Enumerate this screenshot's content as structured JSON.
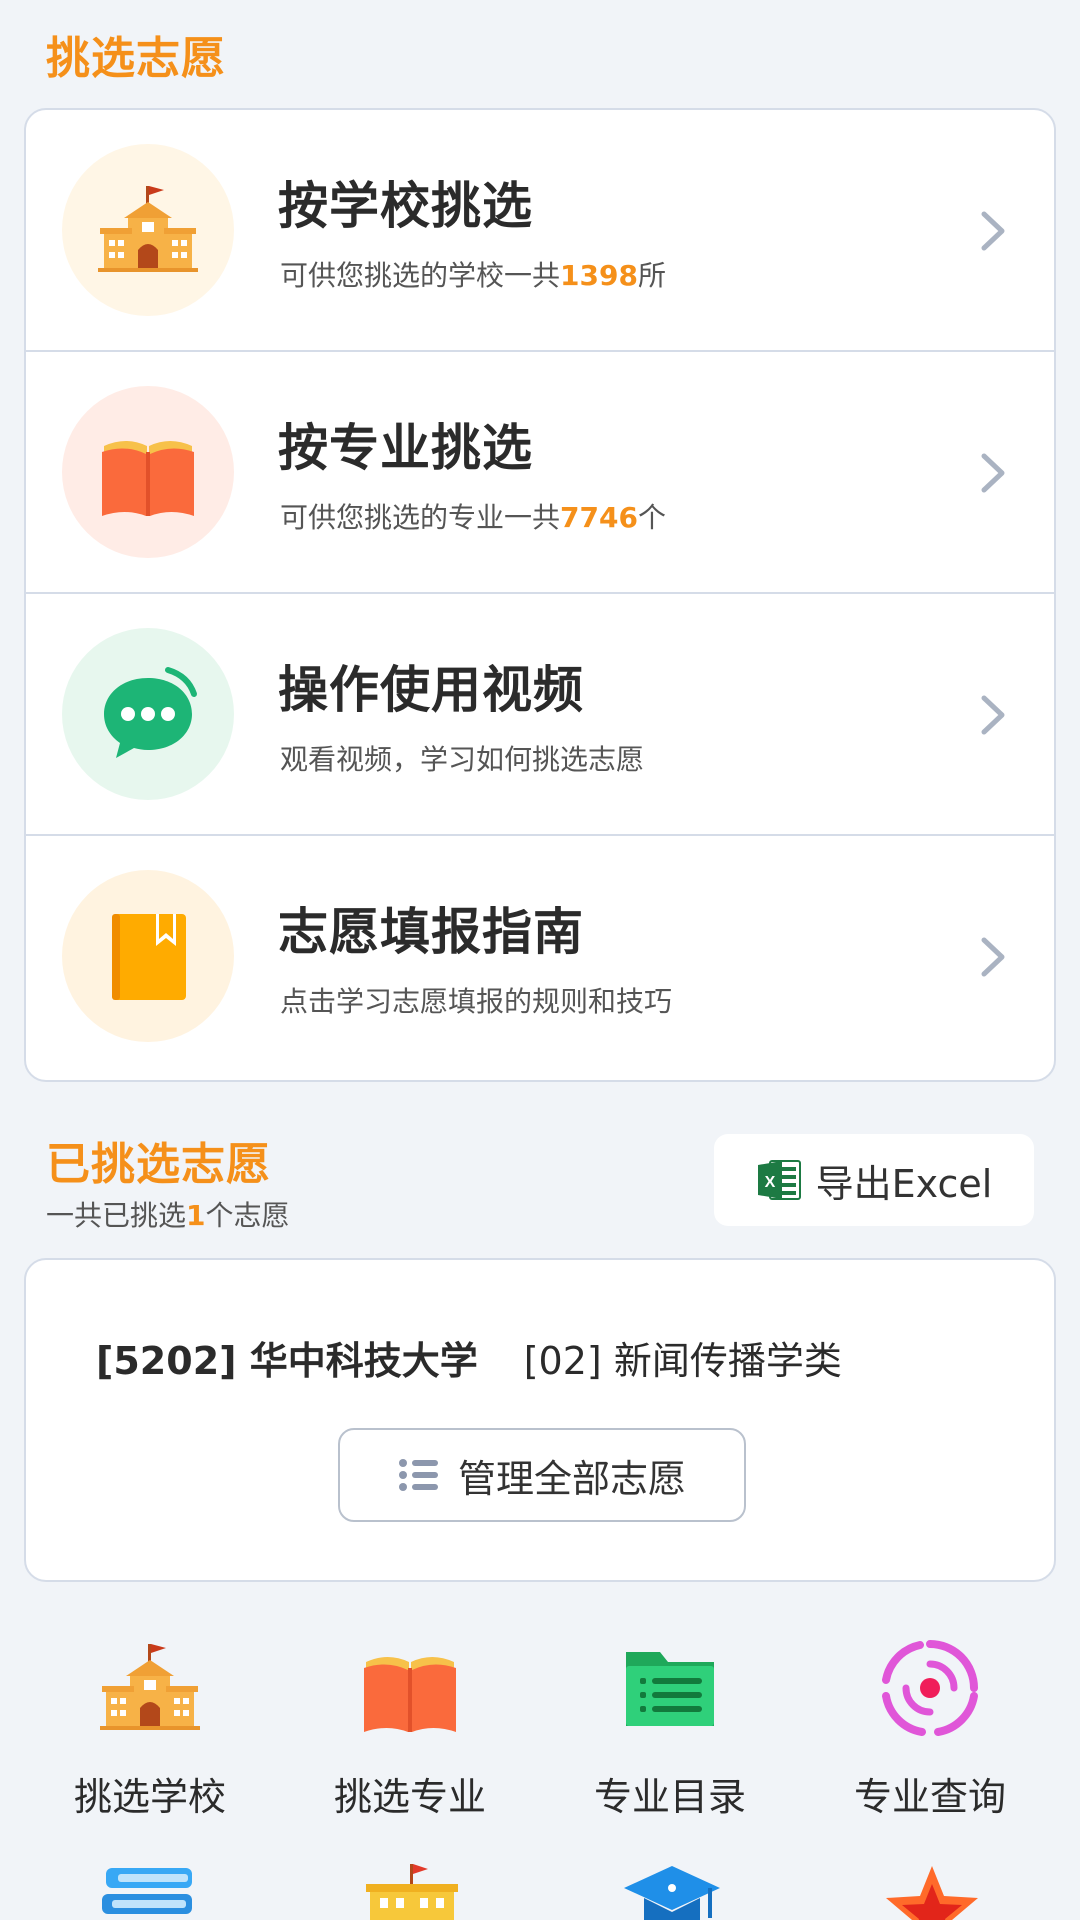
{
  "header": {
    "title": "挑选志愿"
  },
  "options": [
    {
      "title": "按学校挑选",
      "sub_prefix": "可供您挑选的学校一共",
      "count": "1398",
      "sub_suffix": "所",
      "icon": "school-icon",
      "bg": "#fff6e6"
    },
    {
      "title": "按专业挑选",
      "sub_prefix": "可供您挑选的专业一共",
      "count": "7746",
      "sub_suffix": "个",
      "icon": "open-book-icon",
      "bg": "#ffece6"
    },
    {
      "title": "操作使用视频",
      "sub_prefix": "观看视频，学习如何挑选志愿",
      "count": "",
      "sub_suffix": "",
      "icon": "chat-bubble-icon",
      "bg": "#e7f7ee"
    },
    {
      "title": "志愿填报指南",
      "sub_prefix": "点击学习志愿填报的规则和技巧",
      "count": "",
      "sub_suffix": "",
      "icon": "guide-book-icon",
      "bg": "#fff3e0"
    }
  ],
  "chosen": {
    "title": "已挑选志愿",
    "count_prefix": "一共已挑选",
    "count": "1",
    "count_suffix": "个志愿",
    "export_label": "导出Excel",
    "item": {
      "school": "[5202] 华中科技大学",
      "major": "[02] 新闻传播学类"
    },
    "manage_label": "管理全部志愿"
  },
  "grid": [
    {
      "label": "挑选学校",
      "icon": "school-icon"
    },
    {
      "label": "挑选专业",
      "icon": "open-book-icon"
    },
    {
      "label": "专业目录",
      "icon": "folder-list-icon"
    },
    {
      "label": "专业查询",
      "icon": "target-icon"
    }
  ],
  "colors": {
    "accent": "#f5901a",
    "border": "#d5dce8",
    "background": "#f1f4f8"
  }
}
